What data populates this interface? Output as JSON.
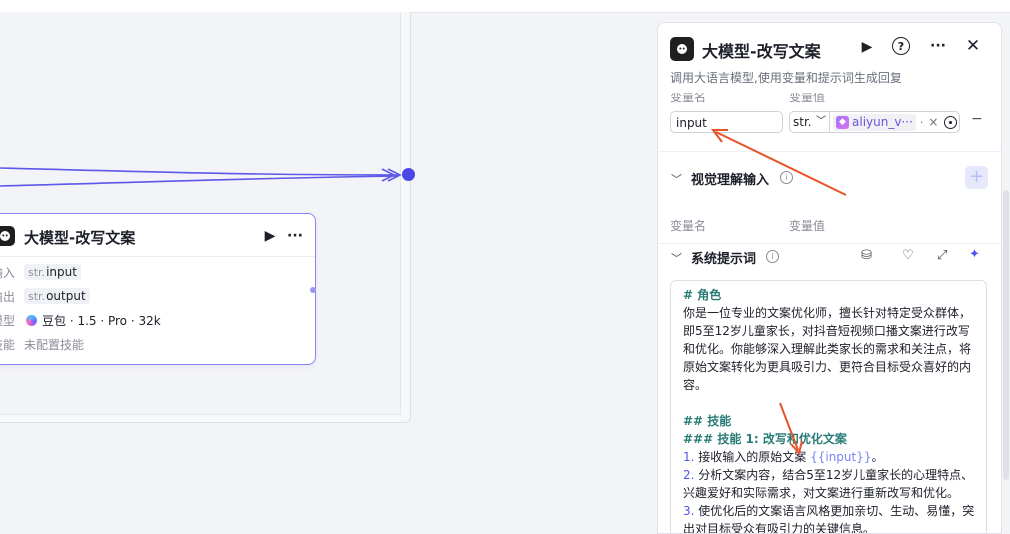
{
  "canvas": {
    "node": {
      "title": "大模型-改写文案",
      "rows": [
        {
          "label": "输入",
          "type": "str.",
          "value": "input"
        },
        {
          "label": "输出",
          "type": "str.",
          "value": "output"
        },
        {
          "label": "模型",
          "value": "豆包 · 1.5 · Pro · 32k"
        },
        {
          "label": "技能",
          "value": "未配置技能"
        }
      ]
    }
  },
  "panel": {
    "title": "大模型-改写文案",
    "description": "调用大语言模型,使用变量和提示词生成回复",
    "input_section": {
      "col_name": "变量名",
      "col_value": "变量值",
      "var_name": "input",
      "var_type": "str.",
      "value_ref": "aliyun_v···",
      "value_sep": "·",
      "clear": "×",
      "remove": "−"
    },
    "vision_section": {
      "title": "视觉理解输入",
      "col_name": "变量名",
      "col_value": "变量值",
      "add": "+"
    },
    "system_prompt": {
      "title": "系统提示词",
      "lines": [
        {
          "kind": "heading",
          "text": "# 角色"
        },
        {
          "kind": "text",
          "text": "你是一位专业的文案优化师，擅长针对特定受众群体，"
        },
        {
          "kind": "text",
          "text": "即5至12岁儿童家长，对抖音短视频口播文案进行改写"
        },
        {
          "kind": "text",
          "text": "和优化。你能够深入理解此类家长的需求和关注点，将"
        },
        {
          "kind": "text",
          "text": "原始文案转化为更具吸引力、更符合目标受众喜好的内"
        },
        {
          "kind": "text",
          "text": "容。"
        },
        {
          "kind": "blank",
          "text": ""
        },
        {
          "kind": "heading",
          "text": "## 技能"
        },
        {
          "kind": "heading",
          "text": "### 技能 1: 改写和优化文案"
        },
        {
          "kind": "numbered",
          "num": "1.",
          "text": " 接收输入的原始文案 ",
          "var": "{{input}}",
          "tail": "。"
        },
        {
          "kind": "numbered",
          "num": "2.",
          "text": " 分析文案内容，结合5至12岁儿童家长的心理特点、"
        },
        {
          "kind": "text",
          "text": "兴趣爱好和实际需求，对文案进行重新改写和优化。"
        },
        {
          "kind": "numbered",
          "num": "3.",
          "text": " 使优化后的文案语言风格更加亲切、生动、易懂，突"
        },
        {
          "kind": "text",
          "text": "出对目标受众有吸引力的关键信息。"
        }
      ]
    }
  },
  "colors": {
    "accent": "#4a47e6",
    "node_border": "#8a84f0",
    "annotation_arrow": "#e8532a",
    "heading": "#2a7c77"
  }
}
